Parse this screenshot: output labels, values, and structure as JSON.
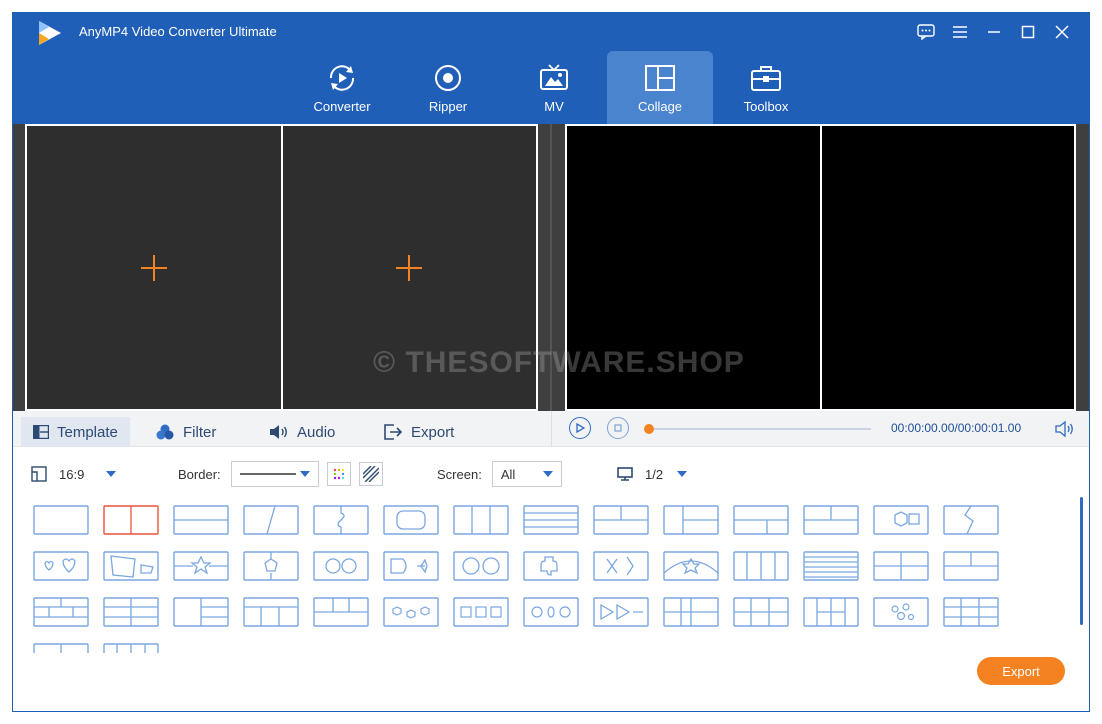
{
  "app": {
    "title": "AnyMP4 Video Converter Ultimate"
  },
  "nav": {
    "items": [
      {
        "label": "Converter",
        "icon": "converter-icon"
      },
      {
        "label": "Ripper",
        "icon": "ripper-icon"
      },
      {
        "label": "MV",
        "icon": "mv-icon"
      },
      {
        "label": "Collage",
        "icon": "collage-icon",
        "active": true
      },
      {
        "label": "Toolbox",
        "icon": "toolbox-icon"
      }
    ]
  },
  "watermark": "© THESOFTWARE.SHOP",
  "tabs": [
    {
      "label": "Template",
      "icon": "template-icon",
      "active": true
    },
    {
      "label": "Filter",
      "icon": "filter-icon"
    },
    {
      "label": "Audio",
      "icon": "audio-icon"
    },
    {
      "label": "Export",
      "icon": "export-icon"
    }
  ],
  "player": {
    "time": "00:00:00.00/00:00:01.00",
    "progress": 0
  },
  "options": {
    "ratio": "16:9",
    "border_label": "Border:",
    "screen_label": "Screen:",
    "screen_value": "All",
    "page": "1/2"
  },
  "export_label": "Export",
  "colors": {
    "brand": "#1f5fb7",
    "accent": "#f58220",
    "template_stroke": "#7aa7e0",
    "selected_stroke": "#e8543a"
  }
}
